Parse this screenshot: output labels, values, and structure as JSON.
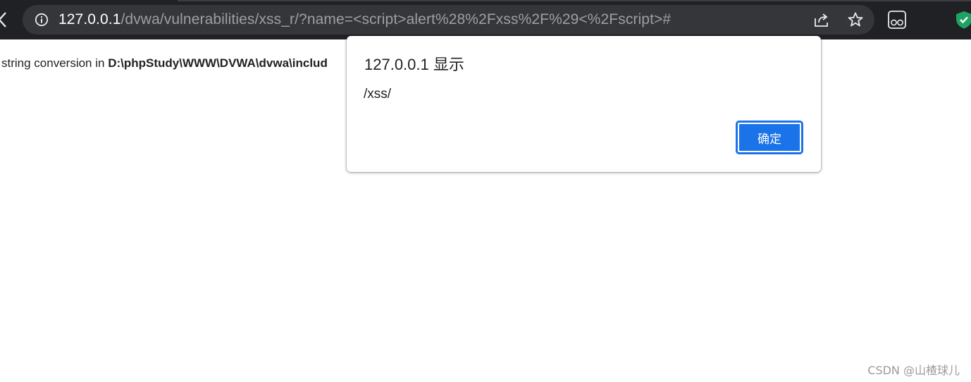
{
  "browser": {
    "url_host": "127.0.0.1",
    "url_path": "/dvwa/vulnerabilities/xss_r/?name=<script>alert%28%2Fxss%2F%29<%2Fscript>#"
  },
  "page": {
    "text_prefix": "string conversion in ",
    "text_path": "D:\\phpStudy\\WWW\\DVWA\\dvwa\\includ"
  },
  "dialog": {
    "title": "127.0.0.1 显示",
    "message": "/xss/",
    "ok_label": "确定"
  },
  "watermark": "CSDN @山楂球儿",
  "colors": {
    "toolbar": "#202124",
    "omnibox": "#35363a",
    "accent": "#1a73e8",
    "shield": "#1ea362"
  }
}
